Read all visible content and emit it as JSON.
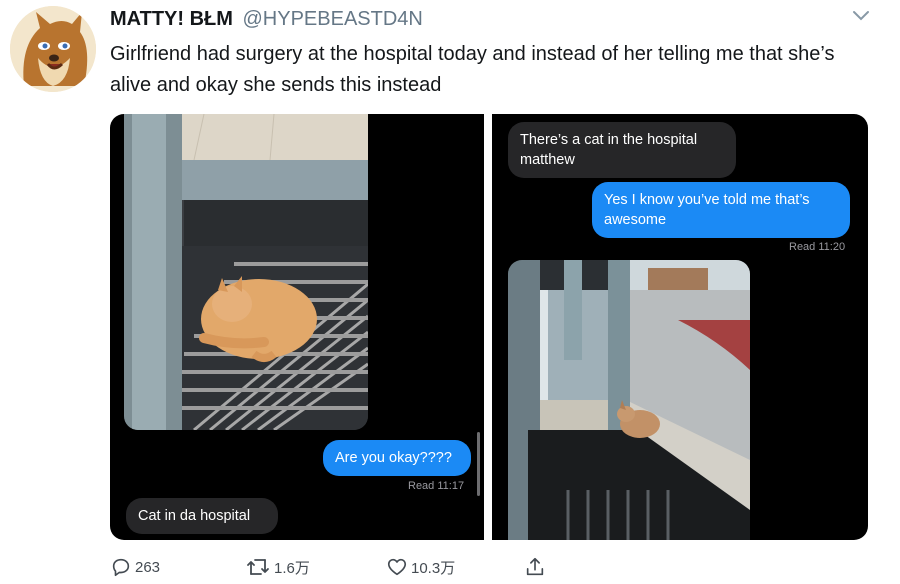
{
  "tweet": {
    "display_name": "MATTY! BŁM",
    "handle": "@HYPEBEASTD4N",
    "text": "Girlfriend had surgery at the hospital today and instead of her telling me that she’s alive and okay she sends this instead"
  },
  "left_screenshot": {
    "sent_message": "Are you okay????",
    "read_receipt": "Read 11:17",
    "received_message": "Cat in da hospital"
  },
  "right_screenshot": {
    "received_message": "There’s a cat in the hospital matthew",
    "sent_message": "Yes I know you’ve told me that’s awesome",
    "read_receipt": "Read 11:20"
  },
  "actions": {
    "replies": "263",
    "retweets": "1.6万",
    "likes": "10.3万"
  },
  "colors": {
    "imessage_blue": "#1b8af5",
    "imessage_gray": "#262628",
    "handle_gray": "#657786"
  },
  "icons": [
    "chevron-down-icon",
    "reply-icon",
    "retweet-icon",
    "like-icon",
    "share-icon"
  ]
}
